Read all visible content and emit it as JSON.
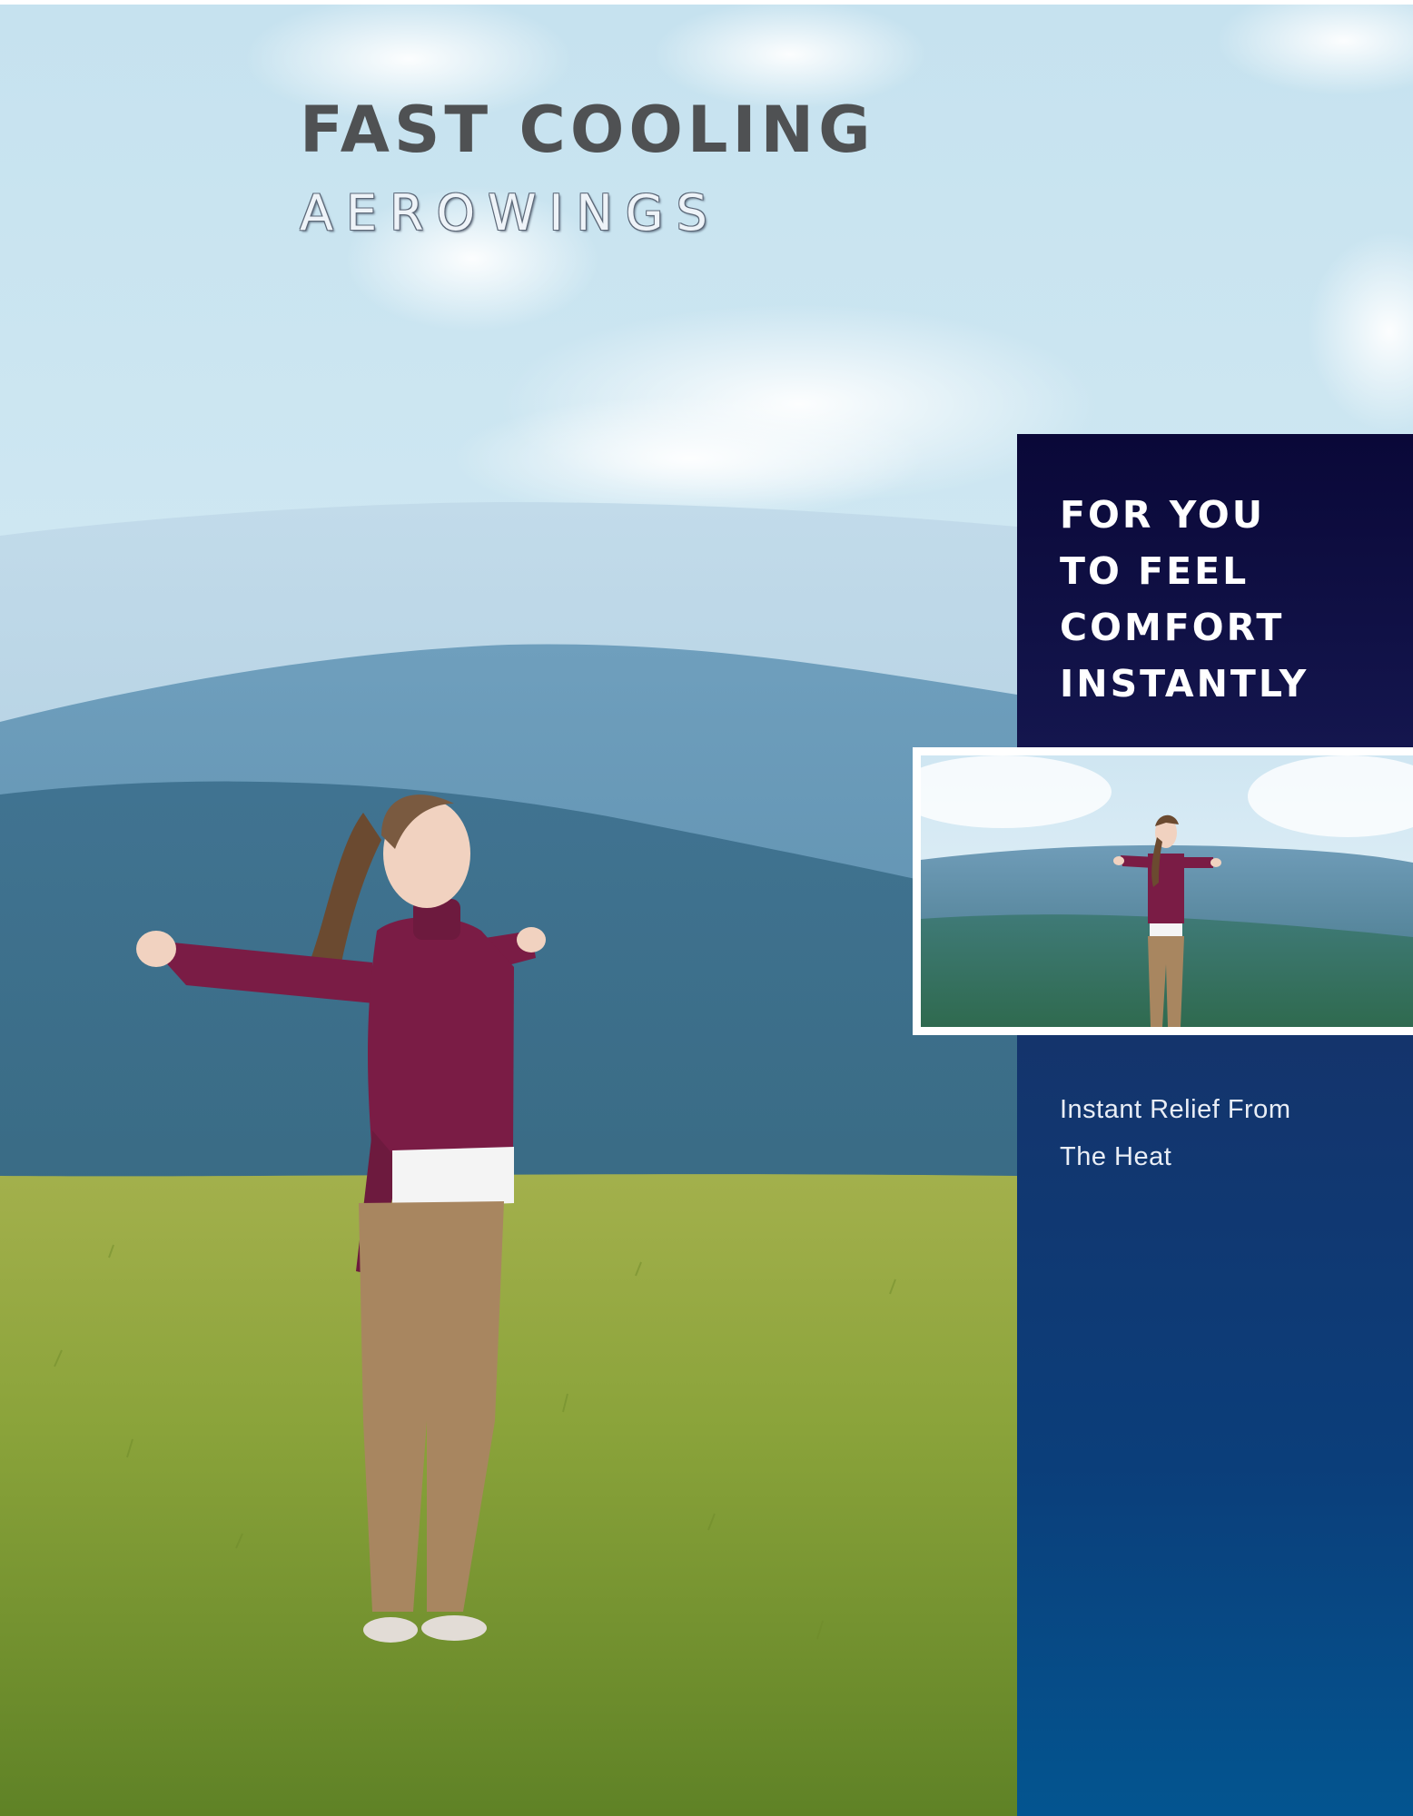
{
  "headline": "FAST COOLING",
  "brand": "AEROWINGS",
  "panel_top": {
    "lines": [
      "FOR YOU",
      "TO FEEL",
      "COMFORT",
      "INSTANTLY"
    ]
  },
  "panel_bottom": {
    "lines": [
      "Instant Relief From",
      "The Heat"
    ]
  },
  "colors": {
    "headline": "#4f5153",
    "panel_top_bg": "#0a0838",
    "panel_bottom_top": "#14346c",
    "panel_bottom_bottom": "#035590",
    "sky": "#b9dcec",
    "grass": "#8aa33a",
    "sweater": "#7a1c45",
    "pants": "#a88660"
  }
}
